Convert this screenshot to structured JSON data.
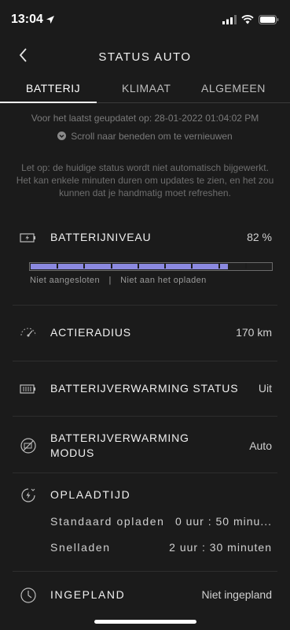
{
  "status_bar": {
    "time": "13:04"
  },
  "header": {
    "title": "STATUS AUTO"
  },
  "tabs": [
    {
      "label": "BATTERIJ",
      "active": true
    },
    {
      "label": "KLIMAAT",
      "active": false
    },
    {
      "label": "ALGEMEEN",
      "active": false
    }
  ],
  "updated_text": "Voor het laatst geupdatet op: 28-01-2022 01:04:02 PM",
  "scroll_hint": "Scroll naar beneden om te vernieuwen",
  "notice": {
    "line1": "Let op: de huidige status wordt niet automatisch bijgewerkt.",
    "line2": "Het kan enkele minuten duren om updates te zien, en het zou kunnen dat je handmatig moet refreshen."
  },
  "battery": {
    "label": "BATTERIJNIVEAU",
    "value": "82 %",
    "level_fraction": 0.82,
    "connection": "Niet aangesloten",
    "separator": "|",
    "charging": "Niet aan het opladen",
    "bar_color": "#8b89e0"
  },
  "range": {
    "label": "ACTIERADIUS",
    "value": "170 km"
  },
  "heating_status": {
    "label": "BATTERIJVERWARMING STATUS",
    "value": "Uit"
  },
  "heating_mode": {
    "label_line1": "BATTERIJVERWARMING",
    "label_line2": "MODUS",
    "value": "Auto"
  },
  "charge_time": {
    "label": "OPLAADTIJD",
    "standard_label": "Standaard opladen",
    "standard_value": "0 uur : 50 minu...",
    "fast_label": "Snelladen",
    "fast_value": "2 uur : 30 minuten"
  },
  "scheduled": {
    "label": "INGEPLAND",
    "value": "Niet ingepland"
  },
  "icons": {
    "back": "chevron-left-icon",
    "battery": "battery-charge-icon",
    "range": "range-gauge-icon",
    "heating_status": "battery-heater-icon",
    "heating_mode": "heater-off-icon",
    "charge_time": "charge-clock-icon",
    "scheduled": "clock-icon"
  }
}
